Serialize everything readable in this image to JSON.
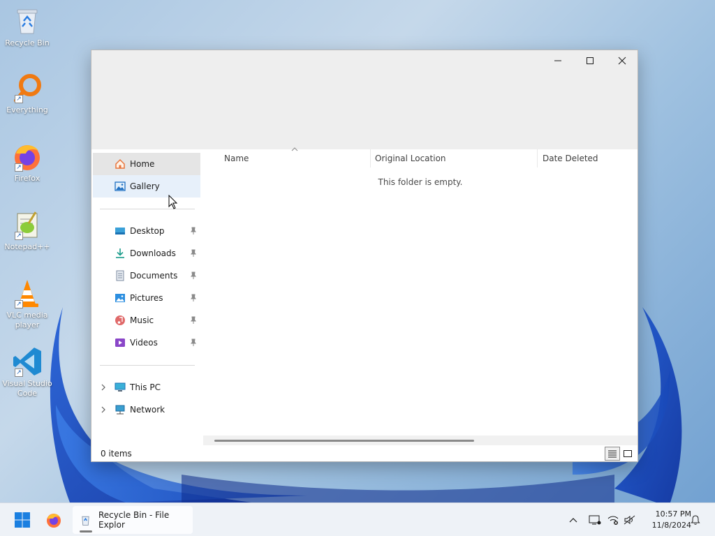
{
  "desktop": {
    "icons": [
      {
        "label": "Recycle Bin",
        "icon": "recycle-bin-icon"
      },
      {
        "label": "Everything",
        "icon": "everything-search-icon"
      },
      {
        "label": "Firefox",
        "icon": "firefox-icon"
      },
      {
        "label": "Notepad++",
        "icon": "notepadpp-icon"
      },
      {
        "label": "VLC media player",
        "icon": "vlc-icon"
      },
      {
        "label": "Visual Studio Code",
        "icon": "vscode-icon"
      }
    ]
  },
  "window": {
    "title": "Recycle Bin - File Explorer",
    "caption": {
      "minimize": "minimize",
      "maximize": "maximize",
      "close": "close"
    },
    "nav": {
      "home": "Home",
      "gallery": "Gallery",
      "quick": [
        {
          "label": "Desktop",
          "icon": "desktop-folder-icon"
        },
        {
          "label": "Downloads",
          "icon": "downloads-folder-icon"
        },
        {
          "label": "Documents",
          "icon": "documents-folder-icon"
        },
        {
          "label": "Pictures",
          "icon": "pictures-folder-icon"
        },
        {
          "label": "Music",
          "icon": "music-folder-icon"
        },
        {
          "label": "Videos",
          "icon": "videos-folder-icon"
        }
      ],
      "this_pc": "This PC",
      "network": "Network"
    },
    "columns": [
      "Name",
      "Original Location",
      "Date Deleted"
    ],
    "empty_message": "This folder is empty.",
    "status": "0 items"
  },
  "taskbar": {
    "app_label": "Recycle Bin - File Explor",
    "time": "10:57 PM",
    "date": "11/8/2024"
  },
  "colors": {
    "accent": "#0078d4",
    "selection": "#e5e5e5",
    "hover": "#e7f0fa"
  }
}
